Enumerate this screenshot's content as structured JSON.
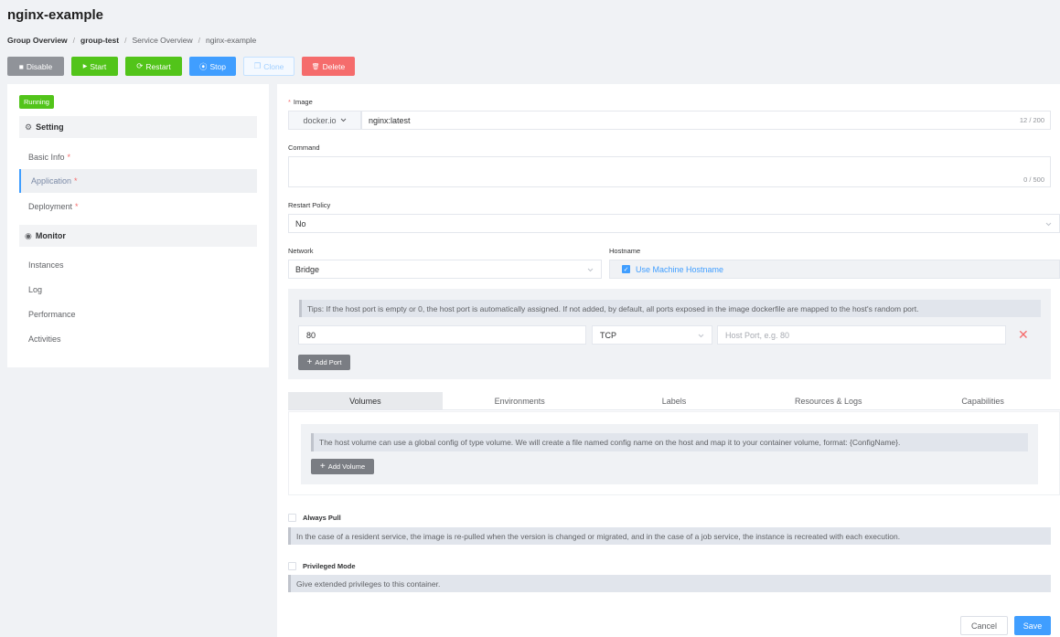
{
  "page": {
    "title": "nginx-example"
  },
  "breadcrumb": [
    {
      "label": "Group Overview"
    },
    {
      "label": "group-test"
    },
    {
      "label": "Service Overview"
    },
    {
      "label": "nginx-example"
    }
  ],
  "breadcrumb_sep": "/",
  "toolbar": {
    "disable_icon": "■",
    "disable": "Disable",
    "start_icon": "▶",
    "start": "Start",
    "restart_icon": "⟳",
    "restart": "Restart",
    "stop_icon": "⦿",
    "stop": "Stop",
    "clone_icon": "❐",
    "clone": "Clone",
    "delete_icon": "🗑",
    "delete": "Delete"
  },
  "sidebar": {
    "status": "Running",
    "setting_icon": "⚙",
    "setting": "Setting",
    "items": [
      {
        "label": "Basic Info",
        "required": "*"
      },
      {
        "label": "Application",
        "required": "*"
      },
      {
        "label": "Deployment",
        "required": "*"
      }
    ],
    "monitor_icon": "◉",
    "monitor": "Monitor",
    "monitor_items": [
      {
        "label": "Instances"
      },
      {
        "label": "Log"
      },
      {
        "label": "Performance"
      },
      {
        "label": "Activities"
      }
    ]
  },
  "form": {
    "required_mark": "*",
    "image_label": "Image",
    "registry": "docker.io",
    "image_value": "nginx:latest",
    "image_count": "12 / 200",
    "command_label": "Command",
    "command_value": "",
    "command_count": "0 / 500",
    "restart_policy_label": "Restart Policy",
    "restart_policy_value": "No",
    "network_label": "Network",
    "network_value": "Bridge",
    "hostname_label": "Hostname",
    "use_machine_hostname": "Use Machine Hostname",
    "use_machine_hostname_checked": true
  },
  "ports": {
    "tips": "Tips: If the host port is empty or 0, the host port is automatically assigned. If not added, by default, all ports exposed in the image dockerfile are mapped to the host's random port.",
    "rows": [
      {
        "container_port": "80",
        "protocol": "TCP",
        "host_port": "",
        "host_port_placeholder": "Host Port, e.g. 80"
      }
    ],
    "remove_icon": "✕",
    "add_icon": "+",
    "add_label": "Add Port"
  },
  "tabs": [
    {
      "label": "Volumes"
    },
    {
      "label": "Environments"
    },
    {
      "label": "Labels"
    },
    {
      "label": "Resources & Logs"
    },
    {
      "label": "Capabilities"
    }
  ],
  "volumes": {
    "tips": "The host volume can use a global config of type volume. We will create a file named config name on the host and map it to your container volume, format: {ConfigName}.",
    "add_icon": "+",
    "add_label": "Add Volume"
  },
  "options": {
    "always_pull_label": "Always Pull",
    "always_pull_note": "In the case of a resident service, the image is re-pulled when the version is changed or migrated, and in the case of a job service, the instance is recreated with each execution.",
    "privileged_label": "Privileged Mode",
    "privileged_note": "Give extended privileges to this container."
  },
  "footer": {
    "cancel": "Cancel",
    "save": "Save"
  },
  "colors": {
    "primary": "#409eff",
    "success": "#52c41a",
    "danger": "#f56c6c",
    "neutral": "#909399"
  }
}
